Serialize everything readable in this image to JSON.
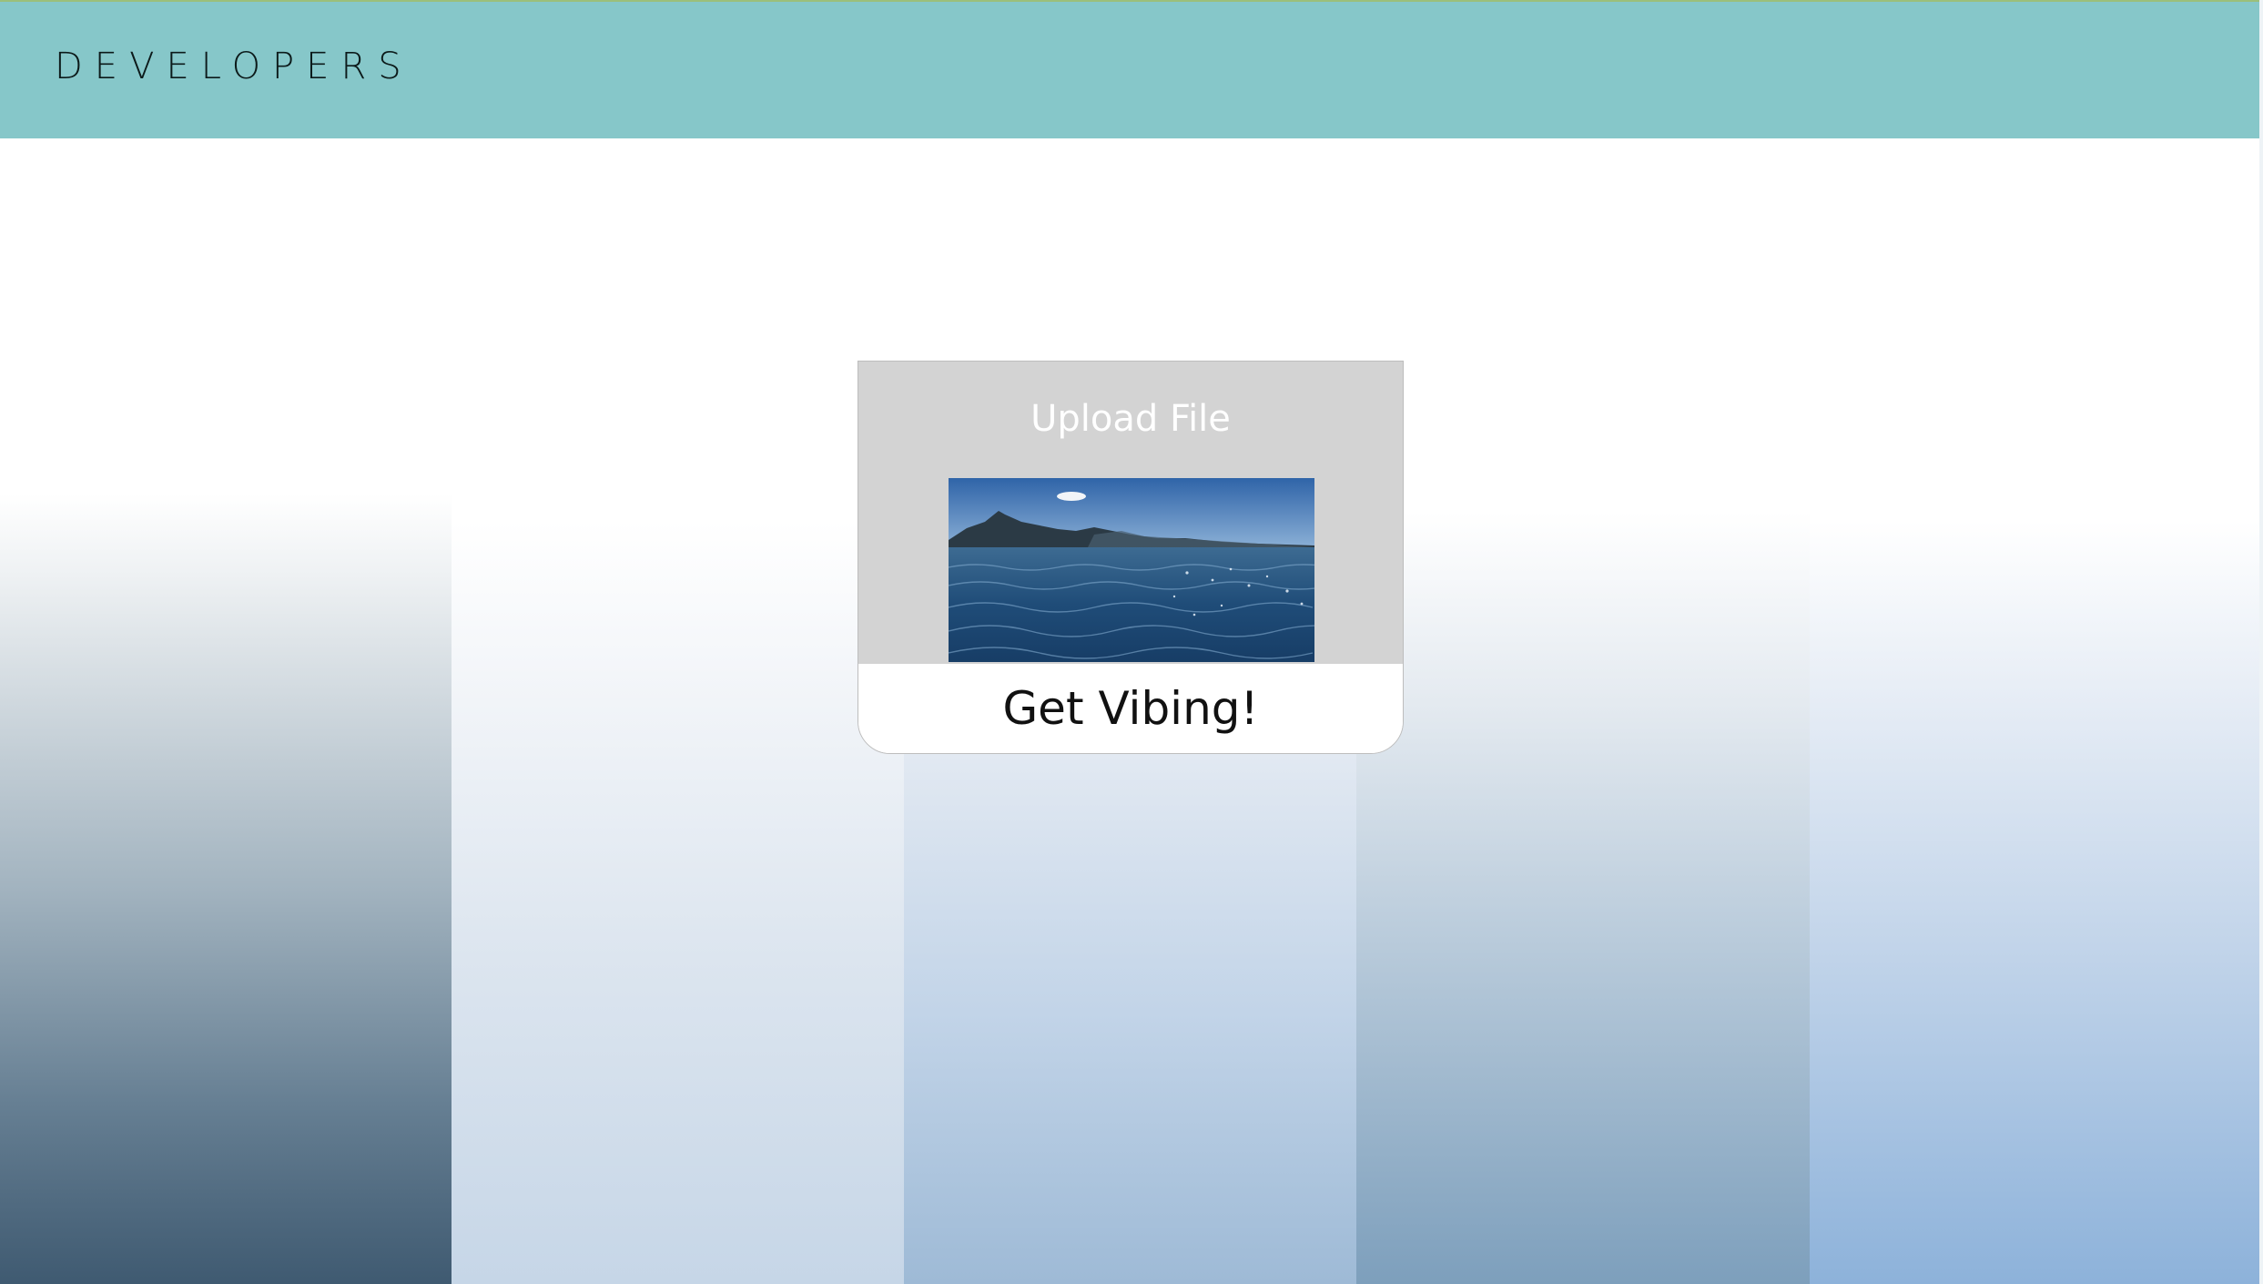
{
  "navbar": {
    "brand": "DEVELOPERS"
  },
  "upload_card": {
    "upload_label": "Upload File",
    "cta_label": "Get Vibing!",
    "preview_image": "ocean-mountain-photo"
  },
  "colors": {
    "navbar": "#86c7c9",
    "card_top": "#d3d3d3",
    "card_bottom": "#ffffff"
  }
}
